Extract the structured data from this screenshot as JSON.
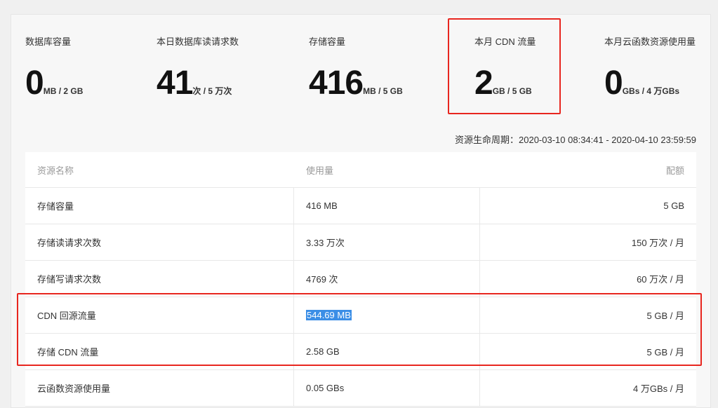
{
  "stats": [
    {
      "label": "数据库容量",
      "big": "0",
      "unit": "MB / 2 GB"
    },
    {
      "label": "本日数据库读请求数",
      "big": "41",
      "unit": "次 / 5 万次"
    },
    {
      "label": "存储容量",
      "big": "416",
      "unit": "MB / 5 GB"
    },
    {
      "label": "本月 CDN 流量",
      "big": "2",
      "unit": "GB / 5 GB"
    },
    {
      "label": "本月云函数资源使用量",
      "big": "0",
      "unit": "GBs / 4 万GBs"
    }
  ],
  "period": "资源生命周期：2020-03-10 08:34:41 - 2020-04-10 23:59:59",
  "table": {
    "headers": [
      "资源名称",
      "使用量",
      "配额"
    ],
    "rows": [
      [
        "存储容量",
        "416 MB",
        "5 GB"
      ],
      [
        "存储读请求次数",
        "3.33 万次",
        "150 万次 / 月"
      ],
      [
        "存储写请求次数",
        "4769 次",
        "60 万次 / 月"
      ],
      [
        "CDN 回源流量",
        "544.69 MB",
        "5 GB / 月"
      ],
      [
        "存储 CDN 流量",
        "2.58 GB",
        "5 GB / 月"
      ],
      [
        "云函数资源使用量",
        "0.05 GBs",
        "4 万GBs / 月"
      ]
    ]
  },
  "colors": {
    "highlight_box": "#e8261f",
    "selection": "#3b8ee6"
  }
}
